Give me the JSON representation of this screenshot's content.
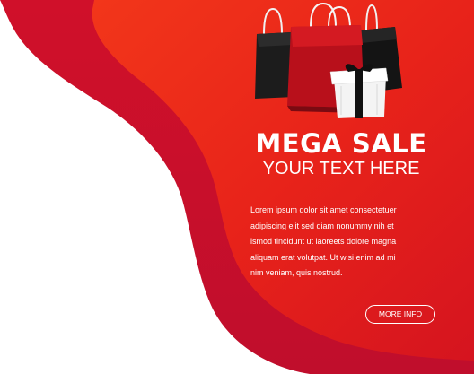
{
  "banner": {
    "headline": "MEGA SALE",
    "subheadline": "YOUR TEXT HERE",
    "body_lines": [
      "Lorem ipsum dolor sit amet consectetuer",
      "adipiscing elit sed diam nonummy nih et",
      "ismod tincidunt ut laoreets dolore magna",
      "aliquam erat volutpat. Ut wisi enim ad mi",
      "nim veniam, quis nostrud."
    ],
    "button_label": "MORE INFO"
  },
  "colors": {
    "background": "#ffffff",
    "red_dark": "#c8102e",
    "red_main": "#e8231a",
    "orange": "#f5401a",
    "bag_black": "#1a1a1a",
    "bag_red": "#c0121c",
    "gift_white": "#f4f4f4",
    "ribbon": "#111111"
  },
  "icons": {
    "bags": "shopping-bags-icon",
    "gift": "gift-box-icon"
  }
}
